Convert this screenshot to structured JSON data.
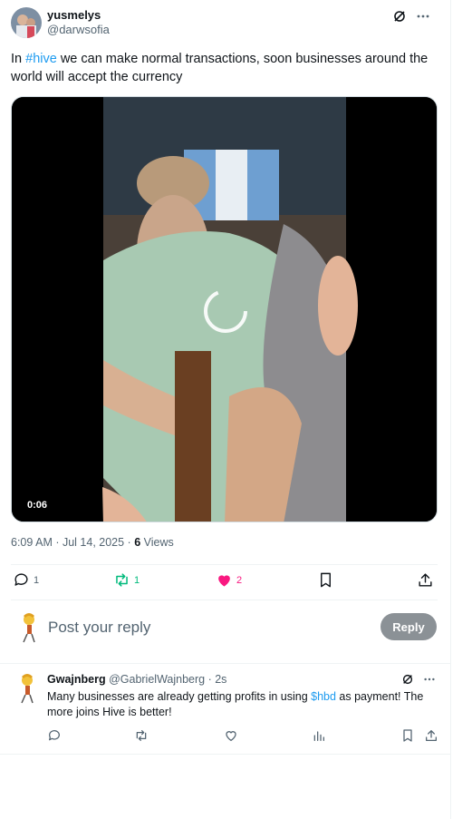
{
  "post": {
    "author_name": "yusmelys",
    "author_handle": "@darwsofia",
    "text_before": "In ",
    "hashtag": "#hive",
    "text_after": " we can make normal transactions, soon businesses around the world will accept the currency",
    "video_duration": "0:06",
    "timestamp": "6:09 AM · Jul 14, 2025 · ",
    "views_count": "6",
    "views_label": " Views",
    "reply_count": "1",
    "repost_count": "1",
    "like_count": "2"
  },
  "reply_box": {
    "placeholder": "Post your reply",
    "button_label": "Reply"
  },
  "comment": {
    "author_name": "Gwajnberg",
    "author_handle": "@GabrielWajnberg",
    "time": " · 2s",
    "text_before": "Many businesses are already getting profits in using ",
    "cashtag": "$hbd",
    "text_after": " as payment! The more joins Hive is better!"
  },
  "colors": {
    "accent": "#1d9bf0",
    "repost_green": "#00ba7c",
    "like_pink": "#f91880",
    "muted": "#536471",
    "reply_button": "#8b9196"
  },
  "icons": [
    "grok-icon",
    "more-icon",
    "reply-icon",
    "repost-icon",
    "like-icon",
    "bookmark-icon",
    "share-icon",
    "analytics-icon"
  ]
}
